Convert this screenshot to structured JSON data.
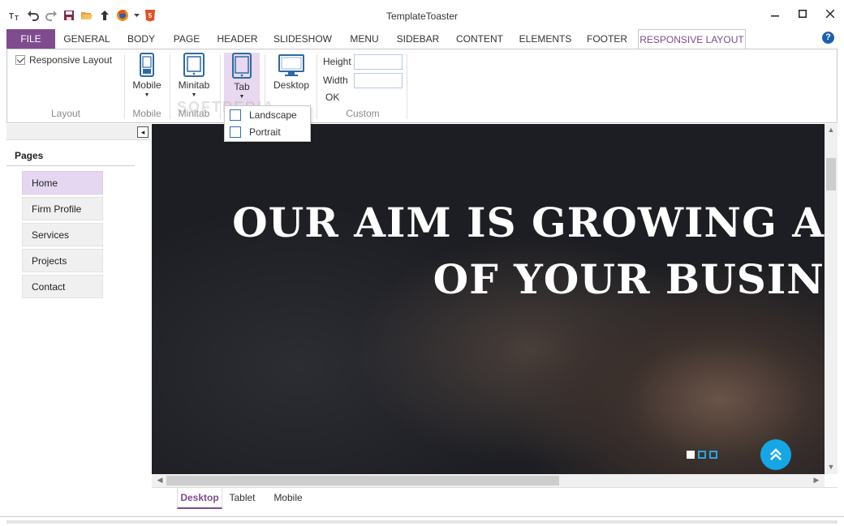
{
  "app": {
    "title": "TemplateToaster"
  },
  "quick_access": [
    {
      "name": "templatetoaster-logo-icon"
    },
    {
      "name": "undo-icon"
    },
    {
      "name": "redo-icon"
    },
    {
      "name": "save-icon"
    },
    {
      "name": "open-folder-icon"
    },
    {
      "name": "upload-icon"
    },
    {
      "name": "firefox-icon"
    },
    {
      "name": "html5-icon"
    }
  ],
  "tabs": [
    "FILE",
    "GENERAL",
    "BODY",
    "PAGE",
    "HEADER",
    "SLIDESHOW",
    "MENU",
    "SIDEBAR",
    "CONTENT",
    "ELEMENTS",
    "FOOTER",
    "RESPONSIVE LAYOUT"
  ],
  "help_label": "?",
  "ribbon": {
    "responsive_layout_label": "Responsive Layout",
    "groups": {
      "layout": "Layout",
      "mobile": "Mobile",
      "minitab": "Minitab",
      "custom": "Custom"
    },
    "buttons": {
      "mobile": "Mobile",
      "minitab": "Minitab",
      "tab": "Tab",
      "desktop": "Desktop"
    },
    "height_label": "Height",
    "width_label": "Width",
    "ok_label": "OK",
    "height_value": "",
    "width_value": ""
  },
  "dropdown": {
    "landscape": "Landscape",
    "portrait": "Portrait"
  },
  "watermark": "SOFTPEDIA",
  "left_panel": {
    "title": "Pages",
    "collapse_glyph": "◂",
    "pages": [
      "Home",
      "Firm Profile",
      "Services",
      "Projects",
      "Contact"
    ]
  },
  "hero": {
    "line1": "OUR AIM IS GROWING A",
    "line2": "OF YOUR BUSIN"
  },
  "bottom_tabs": [
    "Desktop",
    "Tablet",
    "Mobile"
  ],
  "colors": {
    "accent": "#7e4c8f",
    "scroll_top": "#16a6e6",
    "dot": "#2aa6e0"
  }
}
